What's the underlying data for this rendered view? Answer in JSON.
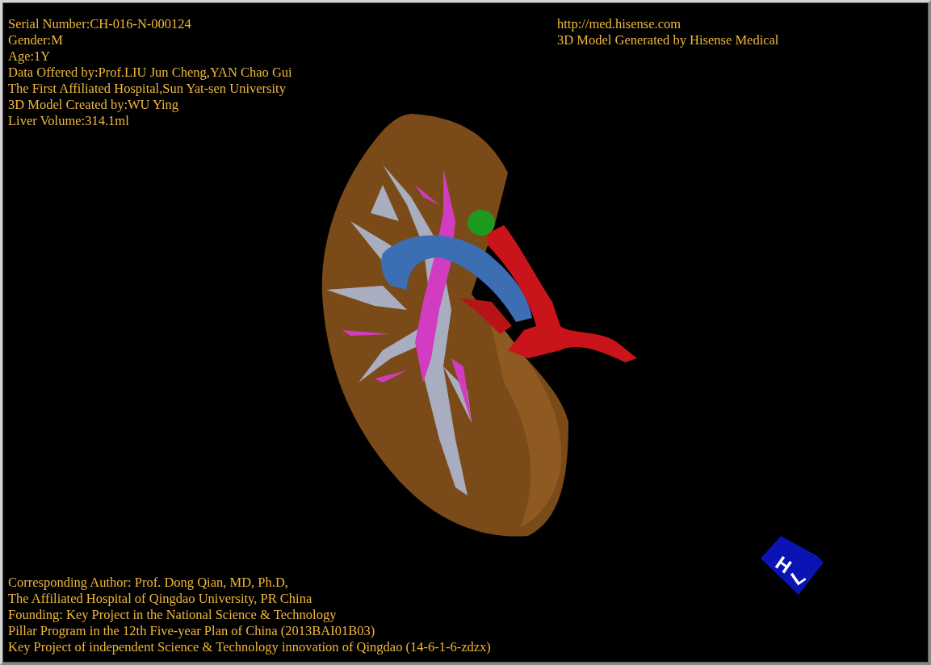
{
  "patient_info": [
    "Serial Number:CH-016-N-000124",
    "Gender:M",
    "Age:1Y",
    "Data Offered by:Prof.LIU Jun Cheng,YAN Chao Gui",
    "The First Affiliated Hospital,Sun Yat-sen University",
    "3D Model Created by:WU Ying",
    "Liver Volume:314.1ml"
  ],
  "source_info": [
    "http://med.hisense.com",
    "3D Model Generated by Hisense Medical"
  ],
  "credits": [
    "Corresponding Author: Prof. Dong Qian, MD, Ph.D,",
    "The Affiliated Hospital of Qingdao University, PR China",
    "Founding: Key Project in the National Science & Technology",
    "Pillar Program in the 12th Five-year Plan of China (2013BAI01B03)",
    "Key Project of independent Science & Technology innovation of Qingdao (14-6-1-6-zdzx)"
  ],
  "orientation_cube": {
    "labels": [
      "H",
      "L"
    ]
  }
}
